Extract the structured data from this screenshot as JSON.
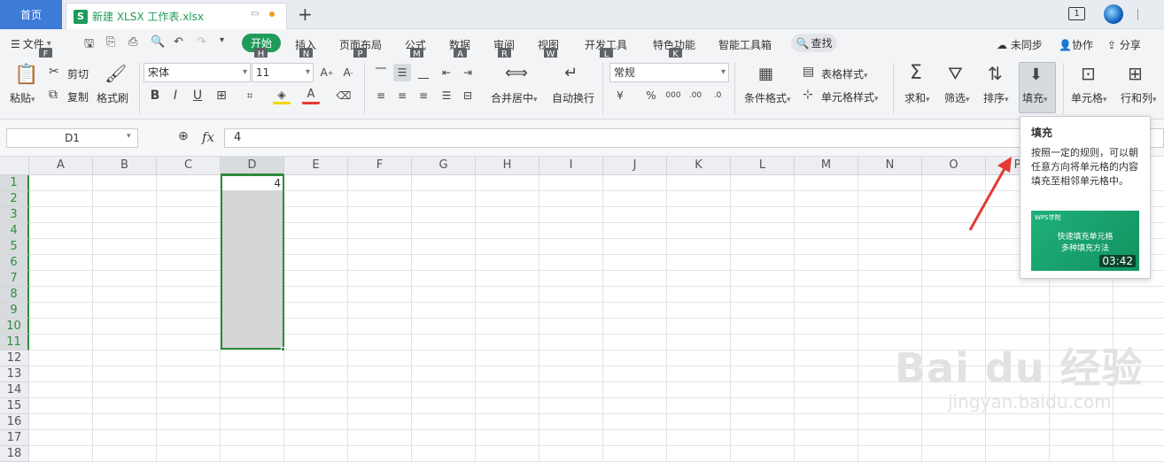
{
  "tabs": {
    "home": "首页",
    "doc_icon": "S",
    "doc_name": "新建 XLSX 工作表.xlsx",
    "add": "+"
  },
  "window": {
    "badge": "1"
  },
  "menubar": {
    "file": "文件",
    "items": [
      "开始",
      "插入",
      "页面布局",
      "公式",
      "数据",
      "审阅",
      "视图",
      "开发工具",
      "特色功能",
      "智能工具箱"
    ],
    "search": "查找",
    "right": [
      "未同步",
      "协作",
      "分享"
    ],
    "keytips": [
      "F",
      "H",
      "N",
      "P",
      "M",
      "A",
      "R",
      "W",
      "L",
      "K"
    ]
  },
  "ribbon": {
    "paste": "粘贴",
    "cut": "剪切",
    "copy": "复制",
    "format_painter": "格式刷",
    "font_name": "宋体",
    "font_size": "11",
    "merge": "合并居中",
    "wrap": "自动换行",
    "number_format": "常规",
    "cond_format": "条件格式",
    "table_style": "表格样式",
    "cell_style": "单元格样式",
    "sum": "求和",
    "filter": "筛选",
    "sort": "排序",
    "fill": "填充",
    "cell": "单元格",
    "row_col": "行和列"
  },
  "formula_bar": {
    "cell_ref": "D1",
    "fx": "fx",
    "value": "4"
  },
  "grid": {
    "columns": [
      "A",
      "B",
      "C",
      "D",
      "E",
      "F",
      "G",
      "H",
      "I",
      "J",
      "K",
      "L",
      "M",
      "N",
      "O",
      "P"
    ],
    "rows": [
      "1",
      "2",
      "3",
      "4",
      "5",
      "6",
      "7",
      "8",
      "9",
      "10",
      "11",
      "12",
      "13",
      "14",
      "15",
      "16",
      "17",
      "18"
    ],
    "d1_value": "4"
  },
  "tooltip": {
    "title": "填充",
    "desc": "按照一定的规则，可以朝任意方向将单元格的内容填充至相邻单元格中。",
    "video_brand": "WPS学院",
    "video_title_1": "快速填充单元格",
    "video_title_2": "多种填充方法",
    "video_time": "03:42"
  },
  "watermark": {
    "main": "Bai du 经验",
    "sub": "jingyan.baidu.com"
  },
  "colors": {
    "accent": "#1f9b59",
    "home_tab": "#3d7bd9",
    "selection": "#2e8b3d",
    "arrow": "#e53935"
  }
}
